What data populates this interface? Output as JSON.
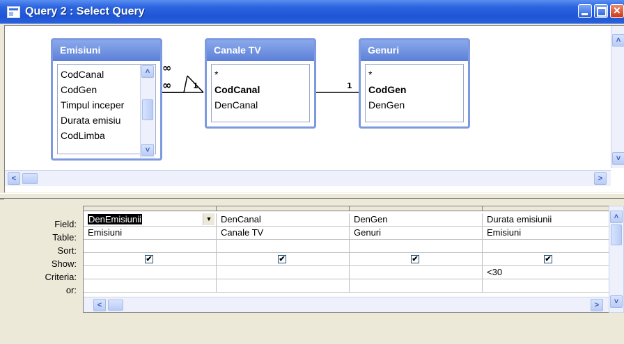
{
  "window": {
    "title": "Query 2 : Select Query"
  },
  "tables": [
    {
      "name": "Emisiuni",
      "fields": [
        "CodCanal",
        "CodGen",
        "Timpul inceper",
        "Durata emisiu",
        "CodLimba"
      ]
    },
    {
      "name": "Canale TV",
      "fields": [
        "*",
        "CodCanal",
        "DenCanal"
      ]
    },
    {
      "name": "Genuri",
      "fields": [
        "*",
        "CodGen",
        "DenGen"
      ]
    }
  ],
  "relations": [
    {
      "many_label": "∞",
      "one_label": "1"
    },
    {
      "many_label": "∞",
      "one_label": "1"
    }
  ],
  "grid": {
    "row_labels": [
      "Field:",
      "Table:",
      "Sort:",
      "Show:",
      "Criteria:",
      "or:"
    ],
    "columns": [
      {
        "field": "DenEmisiunii",
        "table": "Emisiuni",
        "sort": "",
        "show": true,
        "criteria": "",
        "or": ""
      },
      {
        "field": "DenCanal",
        "table": "Canale TV",
        "sort": "",
        "show": true,
        "criteria": "",
        "or": ""
      },
      {
        "field": "DenGen",
        "table": "Genuri",
        "sort": "",
        "show": true,
        "criteria": "",
        "or": ""
      },
      {
        "field": "Durata emisiunii",
        "table": "Emisiuni",
        "sort": "",
        "show": true,
        "criteria": "<30",
        "or": ""
      }
    ]
  },
  "icons": {
    "checkbox_glyph": "✔",
    "dropdown_glyph": "▼",
    "scroll_up": "˄",
    "scroll_down": "˅",
    "scroll_left": "<",
    "scroll_right": ">"
  }
}
